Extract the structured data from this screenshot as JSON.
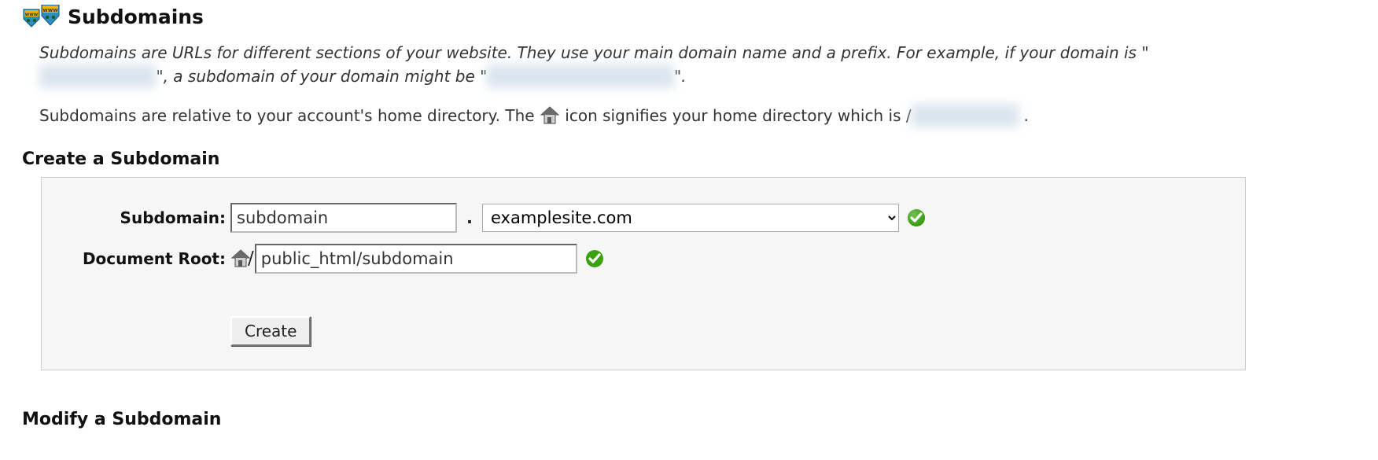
{
  "header": {
    "title": "Subdomains"
  },
  "intro": {
    "italic_part1": "Subdomains are URLs for different sections of your website. They use your main domain name and a prefix. For example, if your domain is \"",
    "italic_part2": "\", a subdomain of your domain might be \"",
    "italic_part3": "\".",
    "text2_part1": "Subdomains are relative to your account's home directory. The ",
    "text2_part2": " icon signifies your home directory which is /",
    "text2_part3": " ."
  },
  "section": {
    "create_heading": "Create a Subdomain",
    "modify_heading": "Modify a Subdomain"
  },
  "form": {
    "subdomain_label": "Subdomain:",
    "subdomain_value": "subdomain",
    "domain_selected": "examplesite.com",
    "docroot_label": "Document Root:",
    "docroot_value": "public_html/subdomain",
    "create_button": "Create",
    "separator_dot": "."
  },
  "redacted": {
    "domain1": "xxxxxxxx xxxx",
    "domain2": "xxxxxxx xxxxxxxx xxxx",
    "homedir": "xxxxxx xxxxx"
  }
}
